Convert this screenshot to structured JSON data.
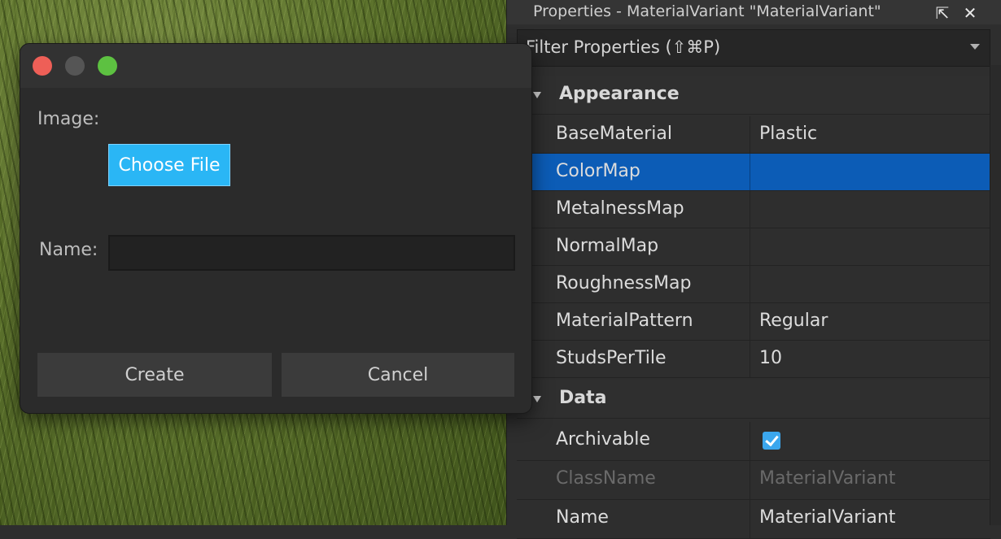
{
  "panel": {
    "title": "Properties - MaterialVariant \"MaterialVariant\"",
    "filter_placeholder": "Filter Properties (⇧⌘P)",
    "sections": [
      {
        "label": "Appearance",
        "rows": [
          {
            "name": "BaseMaterial",
            "value": "Plastic"
          },
          {
            "name": "ColorMap",
            "value": ""
          },
          {
            "name": "MetalnessMap",
            "value": ""
          },
          {
            "name": "NormalMap",
            "value": ""
          },
          {
            "name": "RoughnessMap",
            "value": ""
          },
          {
            "name": "MaterialPattern",
            "value": "Regular"
          },
          {
            "name": "StudsPerTile",
            "value": "10"
          }
        ]
      },
      {
        "label": "Data",
        "rows": [
          {
            "name": "Archivable",
            "value": "",
            "checked": true
          },
          {
            "name": "ClassName",
            "value": "MaterialVariant"
          },
          {
            "name": "Name",
            "value": "MaterialVariant"
          }
        ]
      }
    ],
    "selected_row": "ColorMap"
  },
  "dialog": {
    "image_label": "Image:",
    "choose_file_label": "Choose File",
    "name_label": "Name:",
    "name_value": "",
    "create_label": "Create",
    "cancel_label": "Cancel"
  },
  "colors": {
    "accent": "#2ab6f5",
    "selection": "#0c5cb6",
    "checkbox": "#3ba7ee",
    "close_dot": "#ee5f57",
    "zoom_dot": "#5dc141"
  }
}
